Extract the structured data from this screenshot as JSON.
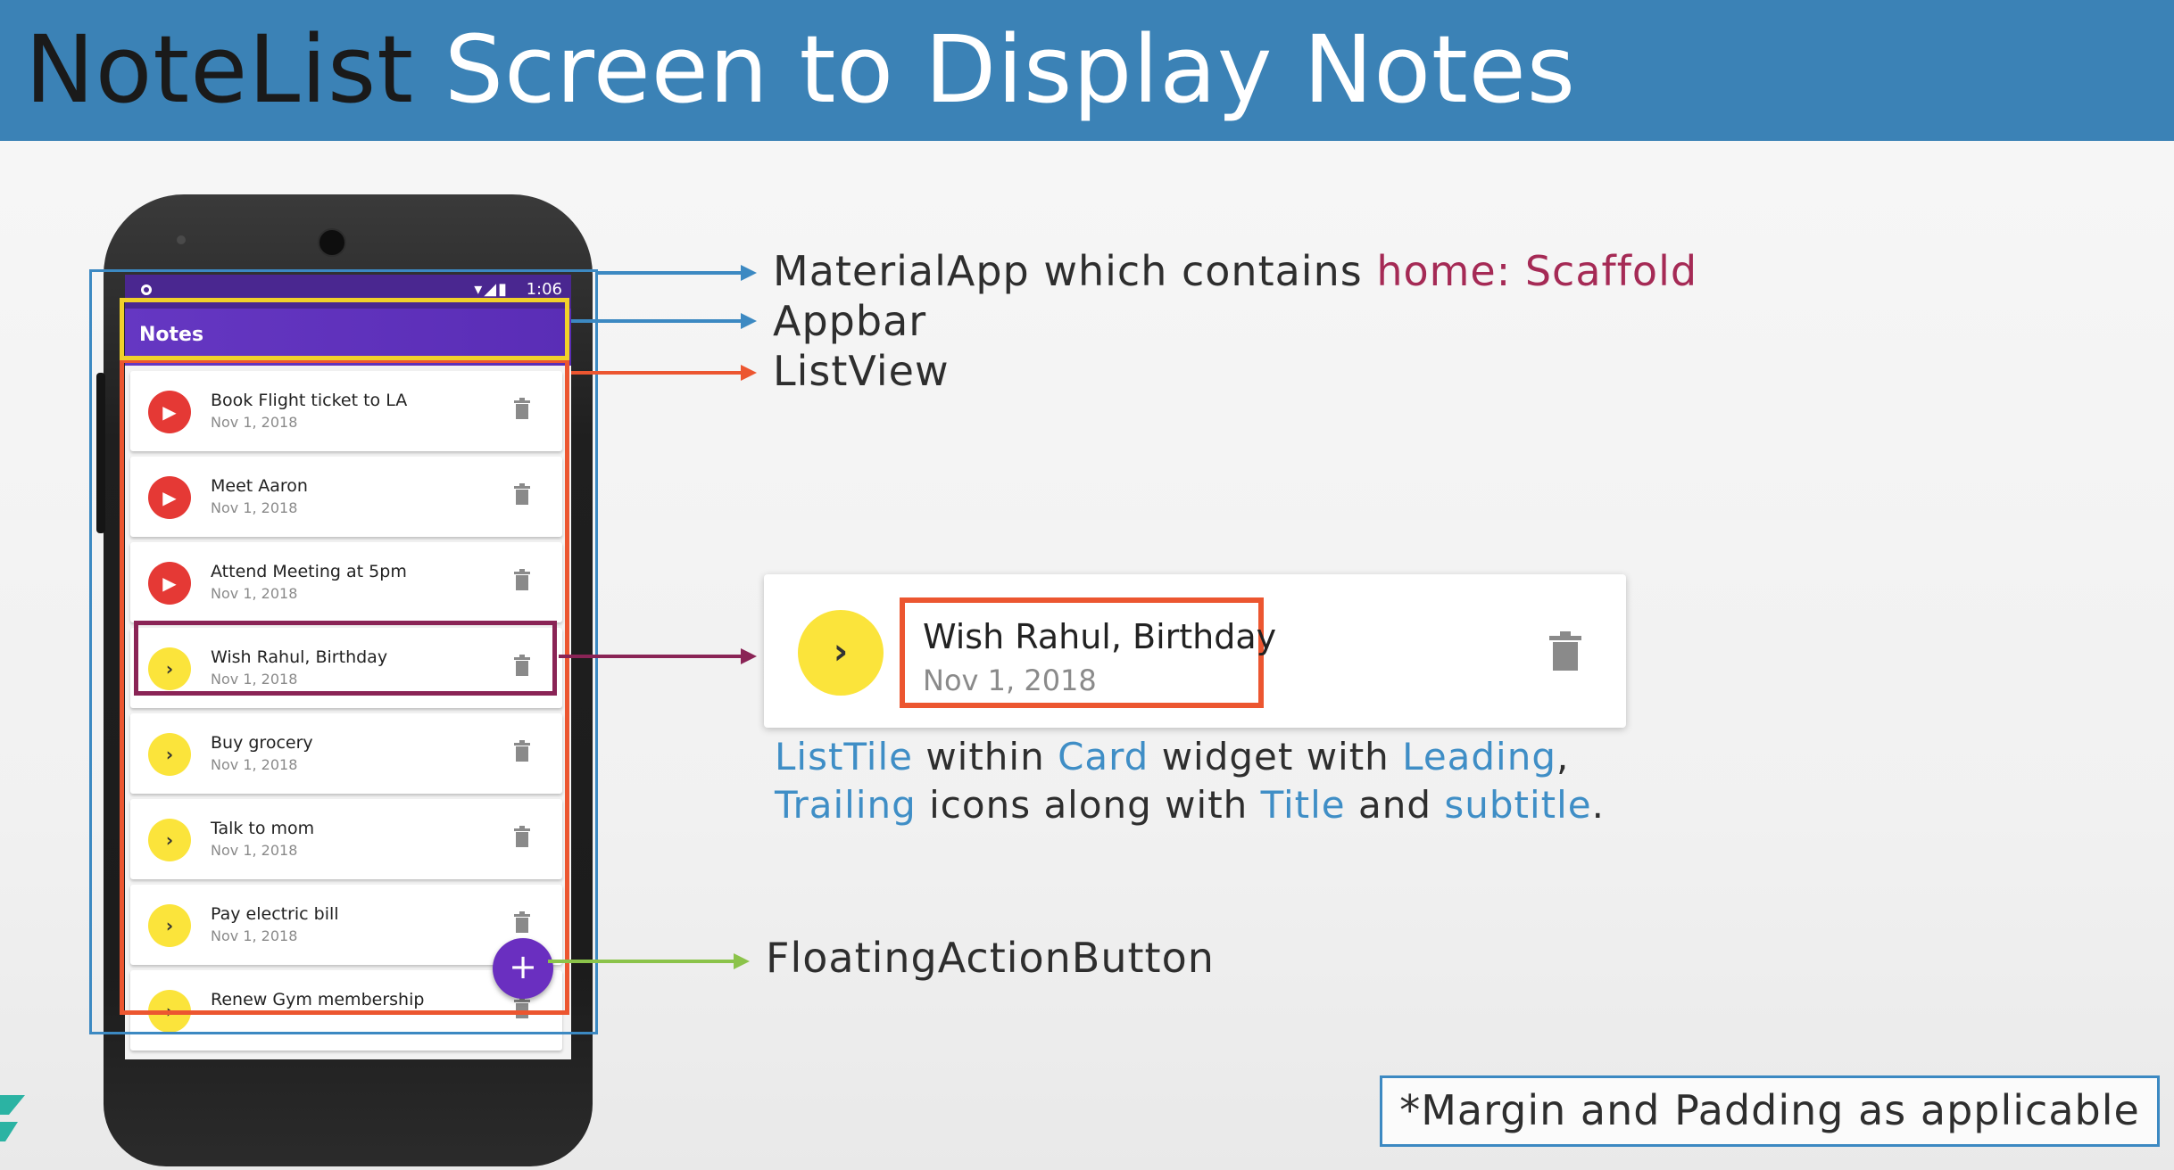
{
  "title": {
    "part1": "NoteList",
    "part2": "Screen to Display Notes"
  },
  "phone": {
    "status_time": "1:06",
    "appbar_title": "Notes",
    "notes": [
      {
        "title": "Book Flight ticket to LA",
        "date": "Nov 1, 2018",
        "priority_color": "#e53935",
        "icon": "play-arrow-icon"
      },
      {
        "title": "Meet Aaron",
        "date": "Nov 1, 2018",
        "priority_color": "#e53935",
        "icon": "play-arrow-icon"
      },
      {
        "title": "Attend Meeting at 5pm",
        "date": "Nov 1, 2018",
        "priority_color": "#e53935",
        "icon": "play-arrow-icon"
      },
      {
        "title": "Wish Rahul, Birthday",
        "date": "Nov 1, 2018",
        "priority_color": "#fbe43b",
        "icon": "chevron-right-icon"
      },
      {
        "title": "Buy grocery",
        "date": "Nov 1, 2018",
        "priority_color": "#fbe43b",
        "icon": "chevron-right-icon"
      },
      {
        "title": "Talk to mom",
        "date": "Nov 1, 2018",
        "priority_color": "#fbe43b",
        "icon": "chevron-right-icon"
      },
      {
        "title": "Pay electric bill",
        "date": "Nov 1, 2018",
        "priority_color": "#fbe43b",
        "icon": "chevron-right-icon"
      },
      {
        "title": "Renew Gym membership",
        "date": "",
        "priority_color": "#fbe43b",
        "icon": "chevron-right-icon"
      }
    ],
    "fab_label": "+"
  },
  "annotations": {
    "material_app": {
      "text": "MaterialApp which contains ",
      "accent": "home: Scaffold"
    },
    "appbar": "Appbar",
    "listview": "ListView",
    "fab": "FloatingActionButton"
  },
  "example_tile": {
    "title": "Wish Rahul, Birthday",
    "subtitle": "Nov 1, 2018"
  },
  "description": {
    "w1": "ListTile",
    "t1": " within ",
    "w2": "Card",
    "t2": " widget with ",
    "w3": "Leading",
    "t3": ",",
    "w4": "Trailing",
    "t4": " icons along with ",
    "w5": "Title",
    "t5": " and ",
    "w6": "subtitle",
    "t6": "."
  },
  "note": "*Margin and Padding as applicable",
  "colors": {
    "header_blue": "#3b82b6",
    "appbar_purple": "#6537c2",
    "high_priority_red": "#e53935",
    "low_priority_yellow": "#fbe43b",
    "accent_text": "#a52a55",
    "link_blue": "#3f8ec6",
    "appbar_highlight": "#f1d12a",
    "listview_highlight": "#ec5630",
    "listtile_highlight": "#8a2456",
    "fab_arrow_green": "#8bc34a"
  }
}
